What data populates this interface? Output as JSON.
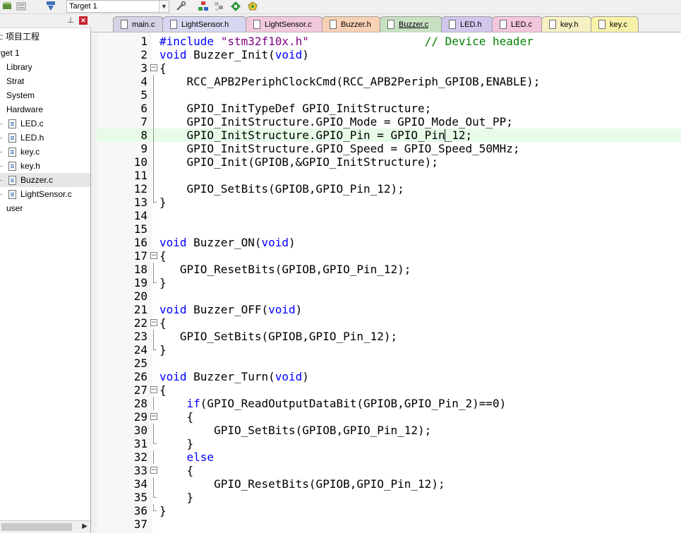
{
  "toolbar": {
    "target_select": "Target 1",
    "icons": [
      "load-layers-icon",
      "rebuild-icon",
      "download-load-icon",
      "target-options-icon",
      "manage-components-icon",
      "pack-installer-icon",
      "manage-project-items-icon",
      "debug-options-icon"
    ]
  },
  "project_panel": {
    "tree": [
      {
        "label": "t: 项目工程",
        "type": "project"
      },
      {
        "label": "rget 1",
        "type": "target"
      },
      {
        "label": "Library",
        "type": "group"
      },
      {
        "label": "Strat",
        "type": "group"
      },
      {
        "label": "System",
        "type": "group"
      },
      {
        "label": "Hardware",
        "type": "group"
      },
      {
        "label": "LED.c",
        "type": "file"
      },
      {
        "label": "LED.h",
        "type": "file"
      },
      {
        "label": "key.c",
        "type": "file"
      },
      {
        "label": "key.h",
        "type": "file"
      },
      {
        "label": "Buzzer.c",
        "type": "file",
        "selected": true
      },
      {
        "label": "LightSensor.c",
        "type": "file"
      },
      {
        "label": "user",
        "type": "group"
      }
    ]
  },
  "tabs": [
    {
      "label": "main.c",
      "color": "#d7d2e6"
    },
    {
      "label": "LightSensor.h",
      "color": "#d7d7f2"
    },
    {
      "label": "LightSensor.c",
      "color": "#f2c9dc"
    },
    {
      "label": "Buzzer.h",
      "color": "#f8d0b4"
    },
    {
      "label": "Buzzer.c",
      "color": "#c7e0c2",
      "active": true
    },
    {
      "label": "LED.h",
      "color": "#d1c6ec"
    },
    {
      "label": "LED.c",
      "color": "#f3c6dc"
    },
    {
      "label": "key.h",
      "color": "#f6f0c2"
    },
    {
      "label": "key.c",
      "color": "#f8f2a8"
    }
  ],
  "editor": {
    "file": "Buzzer.c",
    "highlight_line": 8,
    "caret": {
      "line": 8,
      "column": 42
    },
    "lines": [
      {
        "n": "1",
        "fold": "",
        "segs": [
          [
            "pp",
            "#include "
          ],
          [
            "str",
            "\"stm32f10x.h\""
          ],
          [
            "",
            "                 "
          ],
          [
            "cmt",
            "// Device header"
          ]
        ]
      },
      {
        "n": "2",
        "fold": "",
        "segs": [
          [
            "kw",
            "void"
          ],
          [
            "",
            " Buzzer_Init("
          ],
          [
            "kw",
            "void"
          ],
          [
            "",
            ")"
          ]
        ]
      },
      {
        "n": "3",
        "fold": "open",
        "segs": [
          [
            "",
            "{"
          ]
        ]
      },
      {
        "n": "4",
        "fold": "line",
        "segs": [
          [
            "",
            "    RCC_APB2PeriphClockCmd(RCC_APB2Periph_GPIOB,ENABLE);"
          ]
        ]
      },
      {
        "n": "5",
        "fold": "line",
        "segs": [
          [
            "",
            ""
          ]
        ]
      },
      {
        "n": "6",
        "fold": "line",
        "segs": [
          [
            "",
            "    GPIO_InitTypeDef GPIO_InitStructure;"
          ]
        ]
      },
      {
        "n": "7",
        "fold": "line",
        "segs": [
          [
            "",
            "    GPIO_InitStructure.GPIO_Mode = GPIO_Mode_Out_PP;"
          ]
        ]
      },
      {
        "n": "8",
        "fold": "line",
        "segs": [
          [
            "",
            "    GPIO_InitStructure.GPIO_Pin = GPIO_Pin_12;"
          ]
        ]
      },
      {
        "n": "9",
        "fold": "line",
        "segs": [
          [
            "",
            "    GPIO_InitStructure.GPIO_Speed = GPIO_Speed_50MHz;"
          ]
        ]
      },
      {
        "n": "10",
        "fold": "line",
        "segs": [
          [
            "",
            "    GPIO_Init(GPIOB,&GPIO_InitStructure);"
          ]
        ]
      },
      {
        "n": "11",
        "fold": "line",
        "segs": [
          [
            "",
            ""
          ]
        ]
      },
      {
        "n": "12",
        "fold": "line",
        "segs": [
          [
            "",
            "    GPIO_SetBits(GPIOB,GPIO_Pin_12);"
          ]
        ]
      },
      {
        "n": "13",
        "fold": "end",
        "segs": [
          [
            "",
            "}"
          ]
        ]
      },
      {
        "n": "14",
        "fold": "",
        "segs": [
          [
            "",
            ""
          ]
        ]
      },
      {
        "n": "15",
        "fold": "",
        "segs": [
          [
            "",
            ""
          ]
        ]
      },
      {
        "n": "16",
        "fold": "",
        "segs": [
          [
            "kw",
            "void"
          ],
          [
            "",
            " Buzzer_ON("
          ],
          [
            "kw",
            "void"
          ],
          [
            "",
            ")"
          ]
        ]
      },
      {
        "n": "17",
        "fold": "open",
        "segs": [
          [
            "",
            "{"
          ]
        ]
      },
      {
        "n": "18",
        "fold": "line",
        "segs": [
          [
            "",
            "   GPIO_ResetBits(GPIOB,GPIO_Pin_12);"
          ]
        ]
      },
      {
        "n": "19",
        "fold": "end",
        "segs": [
          [
            "",
            "}"
          ]
        ]
      },
      {
        "n": "20",
        "fold": "",
        "segs": [
          [
            "",
            ""
          ]
        ]
      },
      {
        "n": "21",
        "fold": "",
        "segs": [
          [
            "kw",
            "void"
          ],
          [
            "",
            " Buzzer_OFF("
          ],
          [
            "kw",
            "void"
          ],
          [
            "",
            ")"
          ]
        ]
      },
      {
        "n": "22",
        "fold": "open",
        "segs": [
          [
            "",
            "{"
          ]
        ]
      },
      {
        "n": "23",
        "fold": "line",
        "segs": [
          [
            "",
            "   GPIO_SetBits(GPIOB,GPIO_Pin_12);"
          ]
        ]
      },
      {
        "n": "24",
        "fold": "end",
        "segs": [
          [
            "",
            "}"
          ]
        ]
      },
      {
        "n": "25",
        "fold": "",
        "segs": [
          [
            "",
            ""
          ]
        ]
      },
      {
        "n": "26",
        "fold": "",
        "segs": [
          [
            "kw",
            "void"
          ],
          [
            "",
            " Buzzer_Turn("
          ],
          [
            "kw",
            "void"
          ],
          [
            "",
            ")"
          ]
        ]
      },
      {
        "n": "27",
        "fold": "open",
        "segs": [
          [
            "",
            "{"
          ]
        ]
      },
      {
        "n": "28",
        "fold": "line",
        "segs": [
          [
            "",
            "    "
          ],
          [
            "kw",
            "if"
          ],
          [
            "",
            "(GPIO_ReadOutputDataBit(GPIOB,GPIO_Pin_2)==0)"
          ]
        ]
      },
      {
        "n": "29",
        "fold": "open",
        "segs": [
          [
            "",
            "    {"
          ]
        ]
      },
      {
        "n": "30",
        "fold": "line",
        "segs": [
          [
            "",
            "        GPIO_SetBits(GPIOB,GPIO_Pin_12);"
          ]
        ]
      },
      {
        "n": "31",
        "fold": "end",
        "segs": [
          [
            "",
            "    }"
          ]
        ]
      },
      {
        "n": "32",
        "fold": "line",
        "segs": [
          [
            "",
            "    "
          ],
          [
            "kw",
            "else"
          ]
        ]
      },
      {
        "n": "33",
        "fold": "open",
        "segs": [
          [
            "",
            "    {"
          ]
        ]
      },
      {
        "n": "34",
        "fold": "line",
        "segs": [
          [
            "",
            "        GPIO_ResetBits(GPIOB,GPIO_Pin_12);"
          ]
        ]
      },
      {
        "n": "35",
        "fold": "end",
        "segs": [
          [
            "",
            "    }"
          ]
        ]
      },
      {
        "n": "36",
        "fold": "end",
        "segs": [
          [
            "",
            "}"
          ]
        ]
      },
      {
        "n": "37",
        "fold": "",
        "segs": [
          [
            "",
            ""
          ]
        ]
      }
    ]
  },
  "panel_icons": {
    "pin": "pin-icon",
    "close": "close-icon"
  }
}
